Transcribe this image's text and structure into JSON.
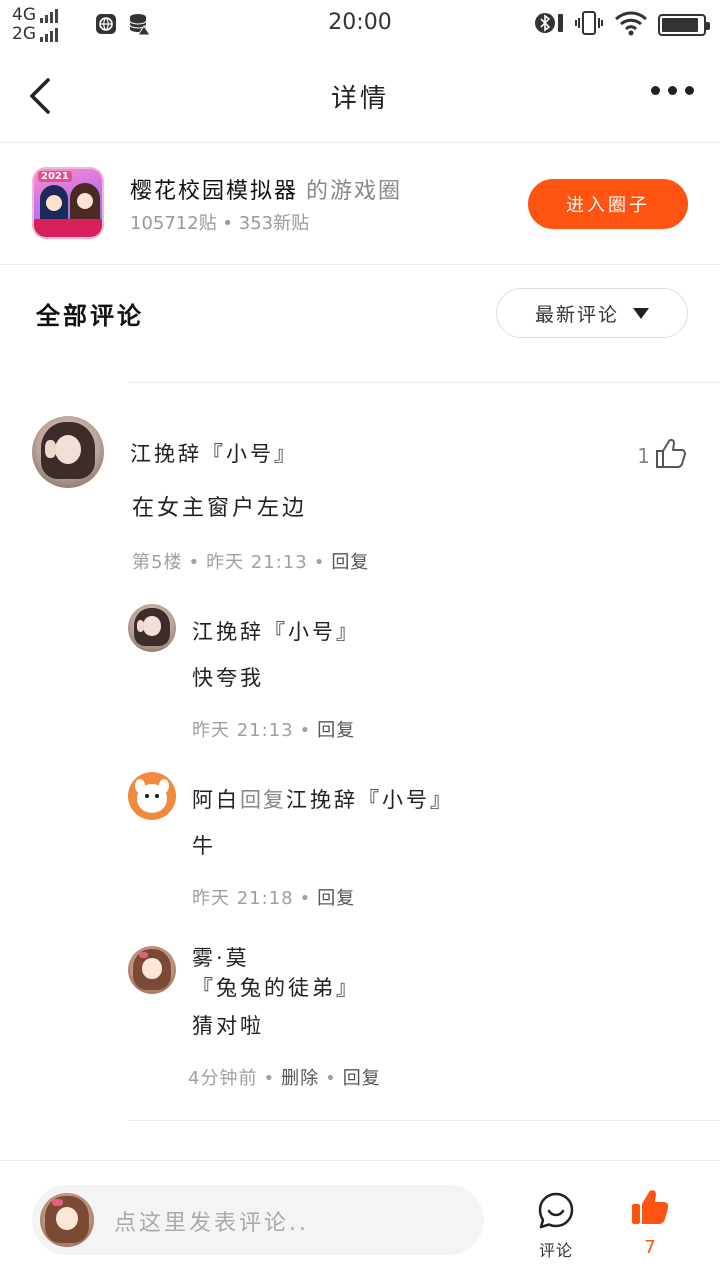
{
  "status_bar": {
    "net1": "4G",
    "net2": "2G",
    "time": "20:00",
    "battery_level": 0.9
  },
  "nav": {
    "title": "详情"
  },
  "circle": {
    "icon_badge": "2021",
    "name": "樱花校园模拟器",
    "suffix": "的游戏圈",
    "stats": "105712贴 • 353新贴",
    "enter_label": "进入圈子"
  },
  "comments_header": {
    "title": "全部评论",
    "sort_label": "最新评论"
  },
  "comment": {
    "author": "江挽辞『小号』",
    "text": "在女主窗户左边",
    "meta_floor": "第5楼",
    "meta_time": "昨天 21:13",
    "reply_label": "回复",
    "likes": "1"
  },
  "replies": [
    {
      "author": "江挽辞『小号』",
      "text": "快夸我",
      "time": "昨天 21:13",
      "reply_label": "回复"
    },
    {
      "author": "阿白",
      "reply_word": "回复",
      "target": "江挽辞『小号』",
      "text": "牛",
      "time": "昨天 21:18",
      "reply_label": "回复"
    },
    {
      "author_line1": "雾·莫",
      "author_line2": "『兔兔的徒弟』",
      "text": "猜对啦",
      "time": "4分钟前",
      "delete_label": "删除",
      "reply_label": "回复"
    }
  ],
  "bottom_bar": {
    "placeholder": "点这里发表评论..",
    "comment_label": "评论",
    "like_count": "7"
  },
  "colors": {
    "accent": "#ff5311",
    "divider": "#ececec",
    "meta": "#a0a0a0"
  },
  "icons": [
    "back-arrow-icon",
    "more-dots-icon",
    "thumbs-up-icon",
    "comment-bubble-icon",
    "sort-caret-icon",
    "globe-icon",
    "database-icon",
    "bluetooth-icon",
    "vibrate-icon",
    "wifi-icon",
    "battery-icon"
  ]
}
